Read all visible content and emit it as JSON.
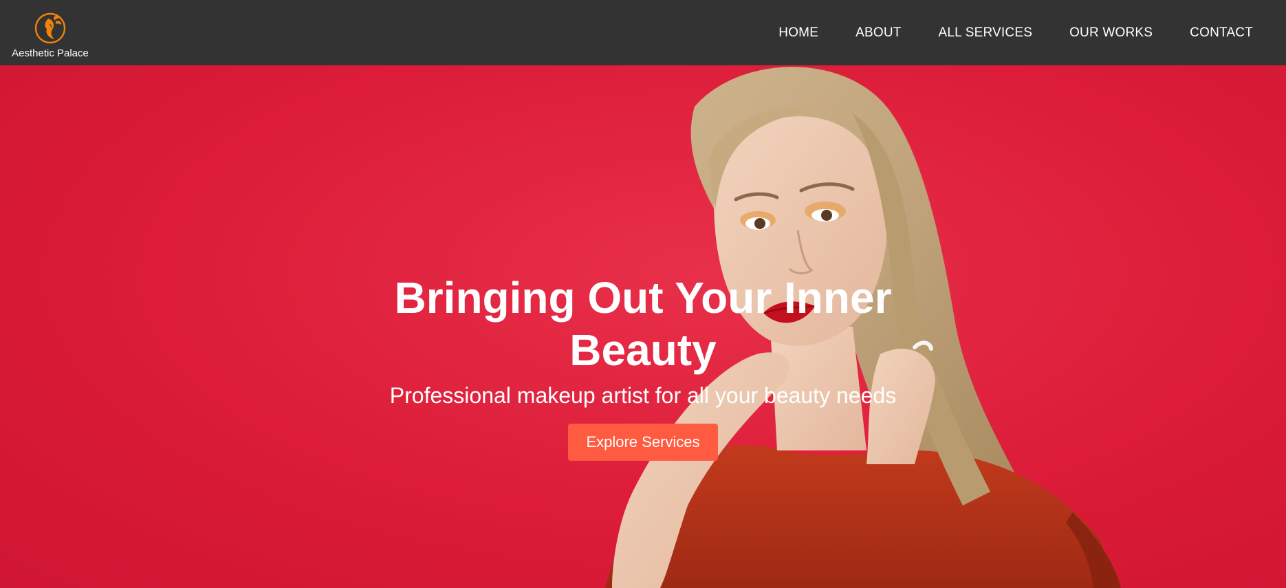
{
  "brand": {
    "name": "Aesthetic Palace",
    "logo_icon": "flower-woman-icon",
    "logo_color": "#f0830a"
  },
  "nav": {
    "items": [
      {
        "label": "HOME"
      },
      {
        "label": "ABOUT"
      },
      {
        "label": "ALL SERVICES"
      },
      {
        "label": "OUR WORKS"
      },
      {
        "label": "CONTACT"
      }
    ]
  },
  "hero": {
    "title": "Bringing Out Your Inner Beauty",
    "subtitle": "Professional makeup artist for all your beauty needs",
    "cta_label": "Explore Services",
    "background_color": "#e0203c",
    "cta_color": "#ff5b40"
  },
  "colors": {
    "navbar": "#333333",
    "text": "#ffffff"
  }
}
